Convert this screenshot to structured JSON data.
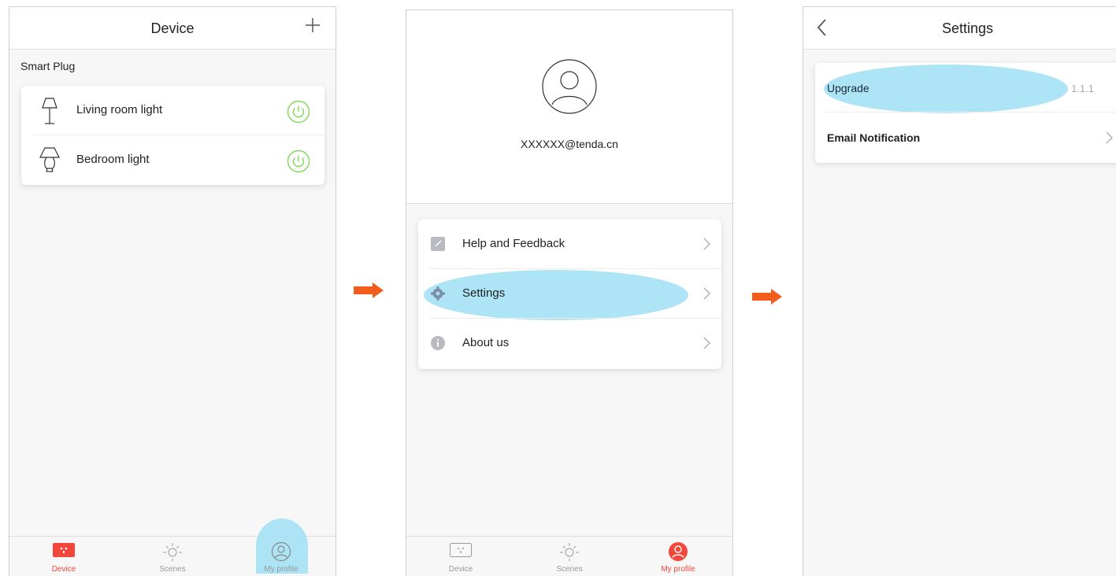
{
  "screen1": {
    "title": "Device",
    "section_label": "Smart Plug",
    "devices": [
      {
        "label": "Living room light",
        "icon": "floor-lamp-icon",
        "power_state": "on"
      },
      {
        "label": "Bedroom light",
        "icon": "table-lamp-icon",
        "power_state": "on"
      }
    ],
    "tabs": [
      {
        "label": "Device",
        "icon": "plug-icon",
        "active": true
      },
      {
        "label": "Scenes",
        "icon": "sun-icon",
        "active": false
      },
      {
        "label": "My profile",
        "icon": "profile-icon",
        "active": false
      }
    ]
  },
  "screen2": {
    "email": "XXXXXX@tenda.cn",
    "menu": [
      {
        "label": "Help and Feedback",
        "icon": "edit-icon"
      },
      {
        "label": "Settings",
        "icon": "gear-icon"
      },
      {
        "label": "About us",
        "icon": "info-icon"
      }
    ],
    "tabs": [
      {
        "label": "Device",
        "icon": "plug-icon",
        "active": false
      },
      {
        "label": "Scenes",
        "icon": "sun-icon",
        "active": false
      },
      {
        "label": "My profile",
        "icon": "profile-icon",
        "active": true
      }
    ]
  },
  "screen3": {
    "title": "Settings",
    "items": [
      {
        "label": "Upgrade",
        "value": "1.1.1"
      },
      {
        "label": "Email Notification",
        "value": ""
      }
    ]
  },
  "colors": {
    "accent": "#f4473b",
    "highlight": "#9fdff5",
    "power_green": "#7ed957",
    "arrow": "#f25c1c"
  }
}
